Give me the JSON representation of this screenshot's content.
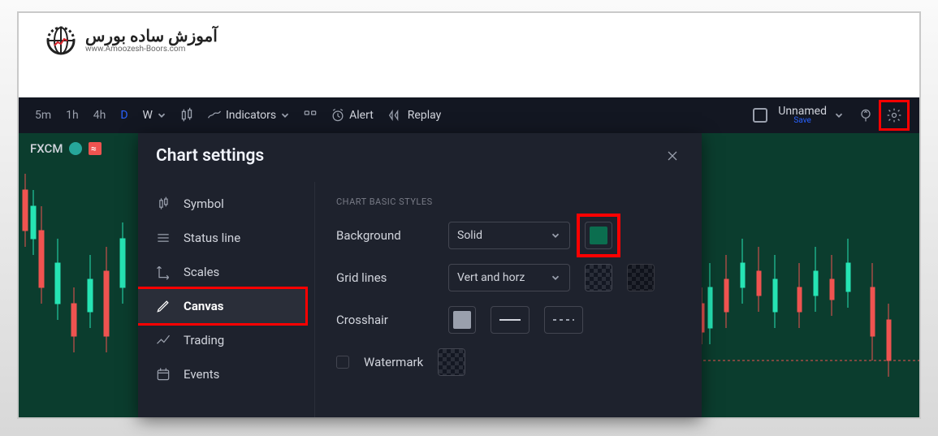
{
  "logo": {
    "arabic": "آموزش ساده بورس",
    "url_line": "www.Amoozesh-Boors.com"
  },
  "toolbar": {
    "intervals": [
      "5m",
      "1h",
      "4h",
      "D",
      "W"
    ],
    "active_interval": "D",
    "indicators_label": "Indicators",
    "alert_label": "Alert",
    "replay_label": "Replay",
    "layout_name": "Unnamed",
    "save_label": "Save"
  },
  "ticker": {
    "symbol": "FXCM"
  },
  "modal": {
    "title": "Chart settings",
    "sidebar": [
      {
        "icon": "candle-icon",
        "label": "Symbol"
      },
      {
        "icon": "lines-icon",
        "label": "Status line"
      },
      {
        "icon": "axes-icon",
        "label": "Scales"
      },
      {
        "icon": "pencil-icon",
        "label": "Canvas",
        "active": true
      },
      {
        "icon": "trend-icon",
        "label": "Trading"
      },
      {
        "icon": "calendar-icon",
        "label": "Events"
      }
    ],
    "section_title": "CHART BASIC STYLES",
    "rows": {
      "background": {
        "label": "Background",
        "select": "Solid"
      },
      "grid": {
        "label": "Grid lines",
        "select": "Vert and horz"
      },
      "crosshair": {
        "label": "Crosshair"
      },
      "watermark": {
        "label": "Watermark"
      }
    }
  }
}
